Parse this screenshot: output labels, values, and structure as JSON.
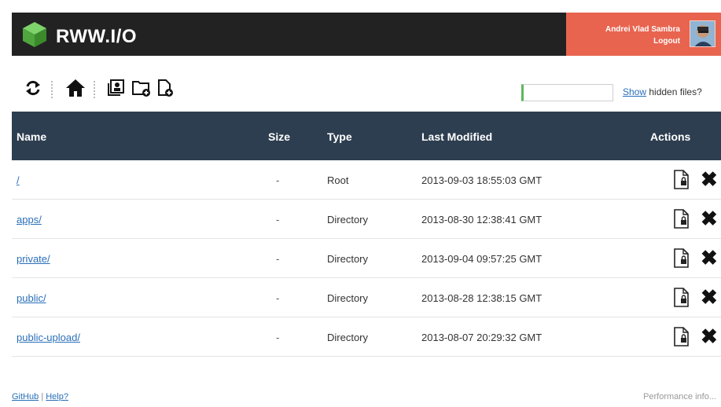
{
  "header": {
    "brand": "RWW.I/O",
    "user_name": "Andrei Vlad Sambra",
    "logout": "Logout"
  },
  "toolbar": {
    "icons": [
      "refresh-icon",
      "home-icon",
      "profile-icon",
      "new-folder-icon",
      "new-file-icon"
    ]
  },
  "search": {
    "value": "",
    "placeholder": ""
  },
  "hidden_files": {
    "link": "Show",
    "text": " hidden files?"
  },
  "table": {
    "headers": {
      "name": "Name",
      "size": "Size",
      "type": "Type",
      "modified": "Last Modified",
      "actions": "Actions"
    },
    "rows": [
      {
        "name": "/",
        "size": "-",
        "type": "Root",
        "modified": "2013-09-03 18:55:03 GMT"
      },
      {
        "name": "apps/",
        "size": "-",
        "type": "Directory",
        "modified": "2013-08-30 12:38:41 GMT"
      },
      {
        "name": "private/",
        "size": "-",
        "type": "Directory",
        "modified": "2013-09-04 09:57:25 GMT"
      },
      {
        "name": "public/",
        "size": "-",
        "type": "Directory",
        "modified": "2013-08-28 12:38:15 GMT"
      },
      {
        "name": "public-upload/",
        "size": "-",
        "type": "Directory",
        "modified": "2013-08-07 20:29:32 GMT"
      }
    ]
  },
  "footer": {
    "github": "GitHub",
    "separator": "|",
    "help": "Help?",
    "performance": "Performance info..."
  },
  "colors": {
    "header_bg": "#222222",
    "user_box": "#e8644f",
    "table_header": "#2d3e50",
    "link": "#2a6fb9",
    "brand_cube": "#5cb85c"
  }
}
